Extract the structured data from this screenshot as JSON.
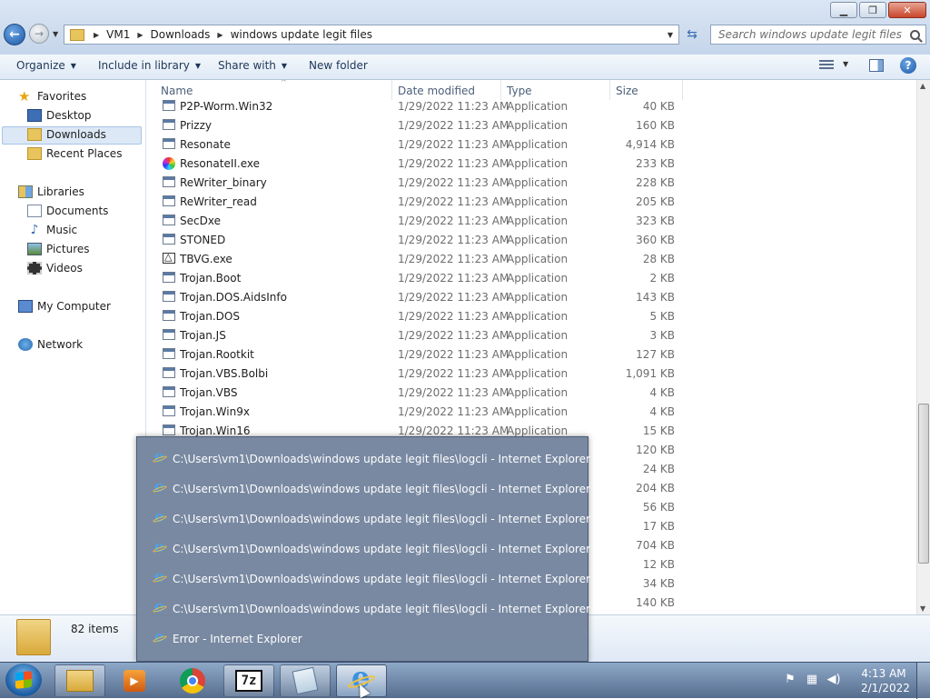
{
  "window": {
    "minimize_glyph": "▁",
    "maximize_glyph": "❐",
    "close_glyph": "✕"
  },
  "navigation": {
    "back_glyph": "←",
    "forward_glyph": "→",
    "breadcrumbs": [
      "VM1",
      "Downloads",
      "windows update legit files"
    ],
    "refresh_glyph": "⇆",
    "search_placeholder": "Search windows update legit files"
  },
  "toolbar": {
    "organize": "Organize",
    "include_in_library": "Include in library",
    "share_with": "Share with",
    "new_folder": "New folder"
  },
  "sidebar": {
    "favorites": "Favorites",
    "desktop": "Desktop",
    "downloads": "Downloads",
    "recent_places": "Recent Places",
    "libraries": "Libraries",
    "documents": "Documents",
    "music": "Music",
    "pictures": "Pictures",
    "videos": "Videos",
    "my_computer": "My Computer",
    "network": "Network"
  },
  "columns": {
    "name": "Name",
    "date_modified": "Date modified",
    "type": "Type",
    "size": "Size"
  },
  "files": [
    {
      "name": "P2P-Worm.Win32",
      "date": "1/29/2022 11:23 AM",
      "type": "Application",
      "size": "40 KB",
      "icon": "app"
    },
    {
      "name": "Prizzy",
      "date": "1/29/2022 11:23 AM",
      "type": "Application",
      "size": "160 KB",
      "icon": "app"
    },
    {
      "name": "Resonate",
      "date": "1/29/2022 11:23 AM",
      "type": "Application",
      "size": "4,914 KB",
      "icon": "app"
    },
    {
      "name": "ResonateII.exe",
      "date": "1/29/2022 11:23 AM",
      "type": "Application",
      "size": "233 KB",
      "icon": "color"
    },
    {
      "name": "ReWriter_binary",
      "date": "1/29/2022 11:23 AM",
      "type": "Application",
      "size": "228 KB",
      "icon": "app"
    },
    {
      "name": "ReWriter_read",
      "date": "1/29/2022 11:23 AM",
      "type": "Application",
      "size": "205 KB",
      "icon": "app"
    },
    {
      "name": "SecDxe",
      "date": "1/29/2022 11:23 AM",
      "type": "Application",
      "size": "323 KB",
      "icon": "app"
    },
    {
      "name": "STONED",
      "date": "1/29/2022 11:23 AM",
      "type": "Application",
      "size": "360 KB",
      "icon": "app"
    },
    {
      "name": "TBVG.exe",
      "date": "1/29/2022 11:23 AM",
      "type": "Application",
      "size": "28 KB",
      "icon": "warn"
    },
    {
      "name": "Trojan.Boot",
      "date": "1/29/2022 11:23 AM",
      "type": "Application",
      "size": "2 KB",
      "icon": "app"
    },
    {
      "name": "Trojan.DOS.AidsInfo",
      "date": "1/29/2022 11:23 AM",
      "type": "Application",
      "size": "143 KB",
      "icon": "app"
    },
    {
      "name": "Trojan.DOS",
      "date": "1/29/2022 11:23 AM",
      "type": "Application",
      "size": "5 KB",
      "icon": "app"
    },
    {
      "name": "Trojan.JS",
      "date": "1/29/2022 11:23 AM",
      "type": "Application",
      "size": "3 KB",
      "icon": "app"
    },
    {
      "name": "Trojan.Rootkit",
      "date": "1/29/2022 11:23 AM",
      "type": "Application",
      "size": "127 KB",
      "icon": "app"
    },
    {
      "name": "Trojan.VBS.Bolbi",
      "date": "1/29/2022 11:23 AM",
      "type": "Application",
      "size": "1,091 KB",
      "icon": "app"
    },
    {
      "name": "Trojan.VBS",
      "date": "1/29/2022 11:23 AM",
      "type": "Application",
      "size": "4 KB",
      "icon": "app"
    },
    {
      "name": "Trojan.Win9x",
      "date": "1/29/2022 11:23 AM",
      "type": "Application",
      "size": "4 KB",
      "icon": "app"
    },
    {
      "name": "Trojan.Win16",
      "date": "1/29/2022 11:23 AM",
      "type": "Application",
      "size": "15 KB",
      "icon": "app"
    },
    {
      "name": "",
      "date": "",
      "type": "",
      "size": "120 KB",
      "icon": ""
    },
    {
      "name": "",
      "date": "",
      "type": "",
      "size": "24 KB",
      "icon": ""
    },
    {
      "name": "",
      "date": "",
      "type": "",
      "size": "204 KB",
      "icon": ""
    },
    {
      "name": "",
      "date": "",
      "type": "",
      "size": "56 KB",
      "icon": ""
    },
    {
      "name": "",
      "date": "",
      "type": "",
      "size": "17 KB",
      "icon": ""
    },
    {
      "name": "",
      "date": "",
      "type": "",
      "size": "704 KB",
      "icon": ""
    },
    {
      "name": "",
      "date": "",
      "type": "",
      "size": "12 KB",
      "icon": ""
    },
    {
      "name": "",
      "date": "",
      "type": "",
      "size": "34 KB",
      "icon": ""
    },
    {
      "name": "",
      "date": "",
      "type": "",
      "size": "140 KB",
      "icon": ""
    }
  ],
  "details": {
    "item_count": "82 items"
  },
  "taskbar_popup": {
    "items": [
      "C:\\Users\\vm1\\Downloads\\windows update legit files\\logcli - Internet Explorer",
      "C:\\Users\\vm1\\Downloads\\windows update legit files\\logcli - Internet Explorer",
      "C:\\Users\\vm1\\Downloads\\windows update legit files\\logcli - Internet Explorer",
      "C:\\Users\\vm1\\Downloads\\windows update legit files\\logcli - Internet Explorer",
      "C:\\Users\\vm1\\Downloads\\windows update legit files\\logcli - Internet Explorer",
      "C:\\Users\\vm1\\Downloads\\windows update legit files\\logcli - Internet Explorer",
      "Error - Internet Explorer"
    ]
  },
  "taskbar": {
    "apps": [
      "windows-explorer-icon",
      "media-player-icon",
      "chrome-icon",
      "7zip-icon",
      "notepad-icon",
      "internet-explorer-icon"
    ],
    "sevenzip_label": "7z",
    "time": "4:13 AM",
    "date": "2/1/2022"
  }
}
